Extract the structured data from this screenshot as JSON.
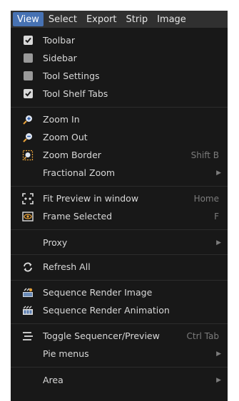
{
  "menubar": {
    "items": [
      {
        "label": "View",
        "active": true
      },
      {
        "label": "Select"
      },
      {
        "label": "Export"
      },
      {
        "label": "Strip"
      },
      {
        "label": "Image"
      }
    ]
  },
  "menu": {
    "toggles": [
      {
        "label": "Toolbar",
        "checked": true
      },
      {
        "label": "Sidebar",
        "checked": false
      },
      {
        "label": "Tool Settings",
        "checked": false
      },
      {
        "label": "Tool Shelf Tabs",
        "checked": true
      }
    ],
    "zoom_in": {
      "label": "Zoom In"
    },
    "zoom_out": {
      "label": "Zoom Out"
    },
    "zoom_border": {
      "label": "Zoom Border",
      "shortcut": "Shift B"
    },
    "fractional_zoom": {
      "label": "Fractional Zoom"
    },
    "fit_preview": {
      "label": "Fit Preview in window",
      "shortcut": "Home"
    },
    "frame_selected": {
      "label": "Frame Selected",
      "shortcut": "F"
    },
    "proxy": {
      "label": "Proxy"
    },
    "refresh_all": {
      "label": "Refresh All"
    },
    "render_image": {
      "label": "Sequence Render Image"
    },
    "render_animation": {
      "label": "Sequence Render Animation"
    },
    "toggle_sequencer": {
      "label": "Toggle Sequencer/Preview",
      "shortcut": "Ctrl Tab"
    },
    "pie_menus": {
      "label": "Pie menus"
    },
    "area": {
      "label": "Area"
    }
  },
  "colors": {
    "accent": "#4772b3",
    "menu_bg": "#181818",
    "text": "#d8d8d8",
    "shortcut": "#7c7c7c"
  }
}
